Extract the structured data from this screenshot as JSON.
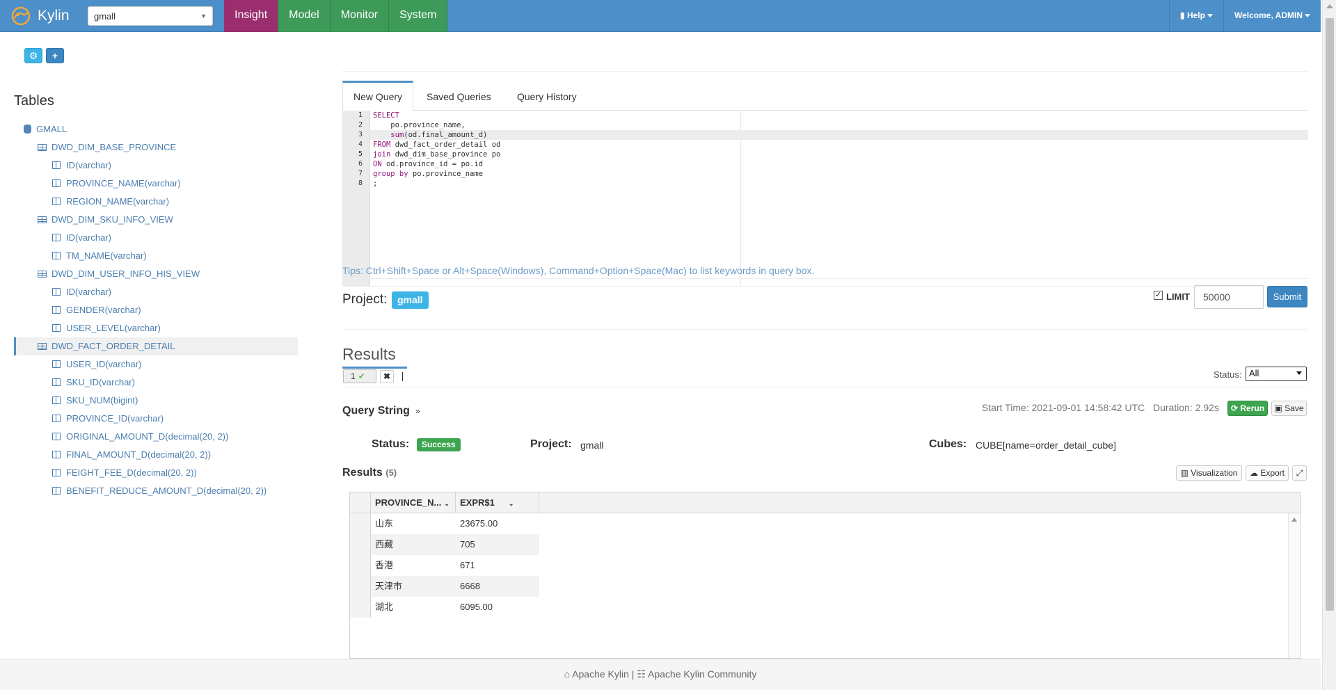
{
  "navbar": {
    "brand": "Kylin",
    "project_select": "gmall",
    "tabs": [
      {
        "label": "Insight",
        "active": true
      },
      {
        "label": "Model",
        "active": false
      },
      {
        "label": "Monitor",
        "active": false
      },
      {
        "label": "System",
        "active": false
      }
    ],
    "help": "Help",
    "welcome": "Welcome, ADMIN"
  },
  "sidebar": {
    "title": "Tables",
    "tree": [
      {
        "kind": "db",
        "label": "GMALL"
      },
      {
        "kind": "tbl",
        "label": "DWD_DIM_BASE_PROVINCE"
      },
      {
        "kind": "col",
        "label": "ID(varchar)"
      },
      {
        "kind": "col",
        "label": "PROVINCE_NAME(varchar)"
      },
      {
        "kind": "col",
        "label": "REGION_NAME(varchar)"
      },
      {
        "kind": "tbl",
        "label": "DWD_DIM_SKU_INFO_VIEW"
      },
      {
        "kind": "col",
        "label": "ID(varchar)"
      },
      {
        "kind": "col",
        "label": "TM_NAME(varchar)"
      },
      {
        "kind": "tbl",
        "label": "DWD_DIM_USER_INFO_HIS_VIEW"
      },
      {
        "kind": "col",
        "label": "ID(varchar)"
      },
      {
        "kind": "col",
        "label": "GENDER(varchar)"
      },
      {
        "kind": "col",
        "label": "USER_LEVEL(varchar)"
      },
      {
        "kind": "tbl",
        "label": "DWD_FACT_ORDER_DETAIL",
        "selected": true
      },
      {
        "kind": "col",
        "label": "USER_ID(varchar)"
      },
      {
        "kind": "col",
        "label": "SKU_ID(varchar)"
      },
      {
        "kind": "col",
        "label": "SKU_NUM(bigint)"
      },
      {
        "kind": "col",
        "label": "PROVINCE_ID(varchar)"
      },
      {
        "kind": "col",
        "label": "ORIGINAL_AMOUNT_D(decimal(20, 2))"
      },
      {
        "kind": "col",
        "label": "FINAL_AMOUNT_D(decimal(20, 2))"
      },
      {
        "kind": "col",
        "label": "FEIGHT_FEE_D(decimal(20, 2))"
      },
      {
        "kind": "col",
        "label": "BENEFIT_REDUCE_AMOUNT_D(decimal(20, 2))"
      }
    ]
  },
  "query_tabs": {
    "new": "New Query",
    "saved": "Saved Queries",
    "history": "Query History"
  },
  "editor": {
    "lines": [
      [
        {
          "t": "SELECT",
          "k": true
        }
      ],
      [
        {
          "t": "    po.province_name,"
        }
      ],
      [
        {
          "t": "    "
        },
        {
          "t": "sum",
          "k": true
        },
        {
          "t": "(od.final_amount_d)"
        }
      ],
      [
        {
          "t": "FROM",
          "k": true
        },
        {
          "t": " dwd_fact_order_detail od"
        }
      ],
      [
        {
          "t": "join",
          "k": true
        },
        {
          "t": " dwd_dim_base_province po"
        }
      ],
      [
        {
          "t": "ON",
          "k": true
        },
        {
          "t": " od.province_id = po.id"
        }
      ],
      [
        {
          "t": "group by",
          "k": true
        },
        {
          "t": " po.province_name"
        }
      ],
      [
        {
          "t": ";"
        }
      ]
    ],
    "highlight_line": 3
  },
  "tips": "Tips: Ctrl+Shift+Space or Alt+Space(Windows), Command+Option+Space(Mac) to list keywords in query box.",
  "project_row": {
    "label": "Project:",
    "badge": "gmall",
    "limit_label": "LIMIT",
    "limit_checked": true,
    "limit_value": "50000",
    "submit": "Submit"
  },
  "results": {
    "title": "Results",
    "tab_label": "1",
    "status_label": "Status:",
    "status_value": "All",
    "query_string": "Query String",
    "start_time": "Start Time: 2021-09-01 14:58:42 UTC",
    "duration": "Duration: 2.92s",
    "rerun": "Rerun",
    "save": "Save",
    "meta": {
      "status_label": "Status:",
      "status_value": "Success",
      "project_label": "Project:",
      "project_value": "gmall",
      "cubes_label": "Cubes:",
      "cubes_value": "CUBE[name=order_detail_cube]"
    },
    "sub_title": "Results",
    "count": "(5)",
    "visualization": "Visualization",
    "export": "Export",
    "columns": [
      "PROVINCE_N...",
      "EXPR$1"
    ],
    "rows": [
      [
        "山东",
        "23675.00"
      ],
      [
        "西藏",
        "705"
      ],
      [
        "香港",
        "671"
      ],
      [
        "天津市",
        "6668"
      ],
      [
        "湖北",
        "6095.00"
      ]
    ]
  },
  "footer": {
    "left": "Apache Kylin",
    "sep": "|",
    "right": "Apache Kylin Community"
  },
  "colors": {
    "navbar": "#4d8fc8",
    "insight": "#9b2e6e",
    "nav_tab": "#3d9a58",
    "success": "#3da54f",
    "link": "#4b7eb0"
  }
}
